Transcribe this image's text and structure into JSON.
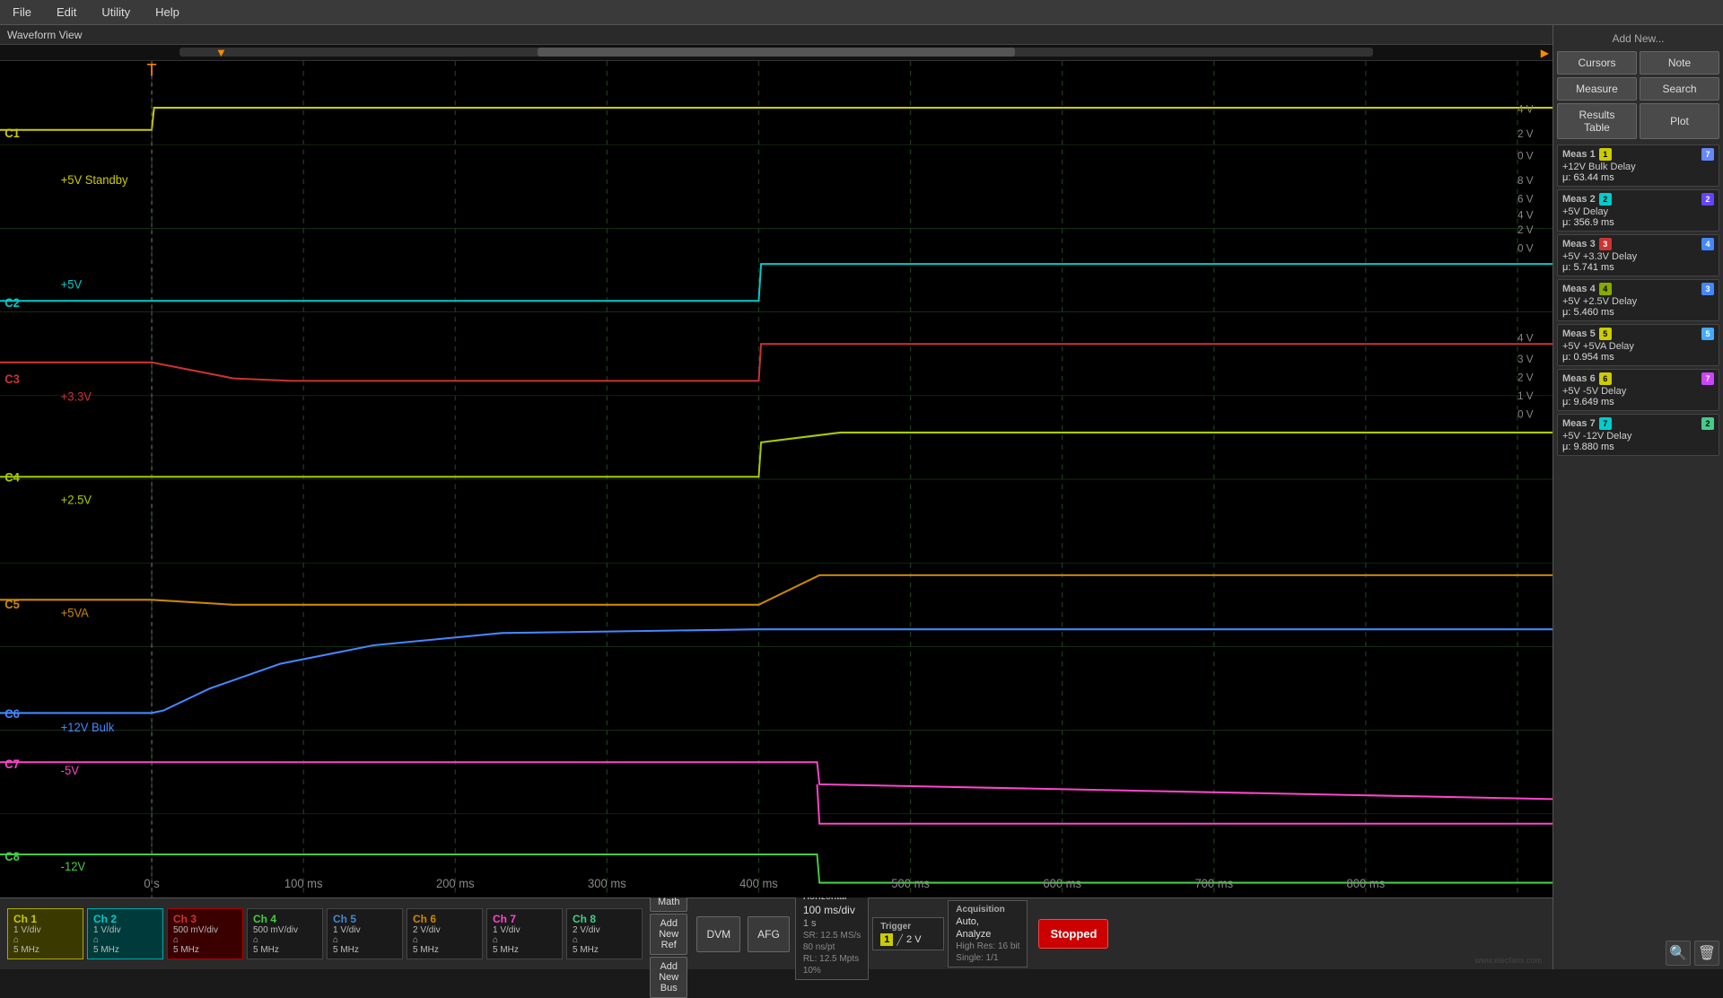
{
  "menubar": {
    "items": [
      "File",
      "Edit",
      "Utility",
      "Help"
    ]
  },
  "waveform": {
    "title": "Waveform View",
    "time_labels": [
      "0 s",
      "100 ms",
      "200 ms",
      "300 ms",
      "400 ms",
      "500 ms",
      "600 ms",
      "700 ms",
      "800 ms"
    ],
    "channels": [
      {
        "id": "C1",
        "name": "+5V Standby",
        "color": "#cccc00",
        "vdiv": "1 V/div",
        "bw": "",
        "y_pct": 12
      },
      {
        "id": "C2",
        "name": "+5V",
        "color": "#00cccc",
        "vdiv": "1 V/div",
        "bw": "",
        "y_pct": 24
      },
      {
        "id": "C3",
        "name": "+3.3V",
        "color": "#cc0000",
        "vdiv": "500 mV/div",
        "bw": "",
        "y_pct": 38
      },
      {
        "id": "C4",
        "name": "+2.5V",
        "color": "#aacc00",
        "vdiv": "500 mV/div",
        "bw": "",
        "y_pct": 50
      },
      {
        "id": "C5",
        "name": "+5VA",
        "color": "#cc8800",
        "vdiv": "1 V/div",
        "bw": "",
        "y_pct": 60
      },
      {
        "id": "C6",
        "name": "+12V Bulk",
        "color": "#4488ff",
        "vdiv": "2 V/div",
        "bw": "",
        "y_pct": 72
      },
      {
        "id": "C7",
        "name": "-5V",
        "color": "#ff44cc",
        "vdiv": "1 V/div",
        "bw": "",
        "y_pct": 78
      },
      {
        "id": "C8",
        "name": "-12V",
        "color": "#44cc44",
        "vdiv": "2 V/div",
        "bw": "",
        "y_pct": 88
      }
    ]
  },
  "right_panel": {
    "add_new_label": "Add New...",
    "buttons": {
      "cursors": "Cursors",
      "note": "Note",
      "measure": "Measure",
      "search": "Search",
      "results_table": "Results\nTable",
      "plot": "Plot"
    },
    "measurements": [
      {
        "id": "Meas 1",
        "badge_num": "1",
        "badge_color": "#cccc00",
        "ch_badge_color": "#6688ff",
        "ch_badge_text": "7",
        "title": "+12V Bulk Delay",
        "value": "μ: 63.44 ms"
      },
      {
        "id": "Meas 2",
        "badge_num": "2",
        "badge_color": "#00cccc",
        "ch_badge_color": "#6644ff",
        "ch_badge_text": "2",
        "title": "+5V Delay",
        "value": "μ: 356.9 ms"
      },
      {
        "id": "Meas 3",
        "badge_num": "3",
        "badge_color": "#cc0000",
        "ch_badge_color": "#4488ff",
        "ch_badge_text": "4",
        "title": "+5V +3.3V Delay",
        "value": "μ: 5.741 ms"
      },
      {
        "id": "Meas 4",
        "badge_num": "4",
        "badge_color": "#88aa00",
        "ch_badge_color": "#4488ff",
        "ch_badge_text": "3",
        "title": "+5V +2.5V Delay",
        "value": "μ: 5.460 ms"
      },
      {
        "id": "Meas 5",
        "badge_num": "5",
        "badge_color": "#cccc00",
        "ch_badge_color": "#44aaff",
        "ch_badge_text": "5",
        "title": "+5V +5VA Delay",
        "value": "μ: 0.954 ms"
      },
      {
        "id": "Meas 6",
        "badge_num": "6",
        "badge_color": "#cccc00",
        "ch_badge_color": "#cc44ff",
        "ch_badge_text": "7",
        "title": "+5V -5V Delay",
        "value": "μ: 9.649 ms"
      },
      {
        "id": "Meas 7",
        "badge_num": "7",
        "badge_color": "#00cccc",
        "ch_badge_color": "#44cc88",
        "ch_badge_text": "2",
        "title": "+5V -12V Delay",
        "value": "μ: 9.880 ms"
      }
    ]
  },
  "bottom_toolbar": {
    "channels": [
      {
        "id": "Ch 1",
        "vdiv": "1 V/div",
        "bw": "⌂",
        "freq": "5 MHz",
        "class": "active-ch1",
        "color": "#cccc00"
      },
      {
        "id": "Ch 2",
        "vdiv": "1 V/div",
        "bw": "⌂",
        "freq": "5 MHz",
        "class": "active-ch2",
        "color": "#00cccc"
      },
      {
        "id": "Ch 3",
        "vdiv": "500 mV/div",
        "bw": "⌂",
        "freq": "5 MHz",
        "class": "active-ch3",
        "color": "#cc3333"
      },
      {
        "id": "Ch 4",
        "vdiv": "500 mV/div",
        "bw": "⌂",
        "freq": "5 MHz",
        "class": "active-ch4",
        "color": "#44cc44"
      },
      {
        "id": "Ch 5",
        "vdiv": "1 V/div",
        "bw": "⌂",
        "freq": "5 MHz",
        "class": "active-ch5",
        "color": "#4466cc"
      },
      {
        "id": "Ch 6",
        "vdiv": "2 V/div",
        "bw": "⌂",
        "freq": "5 MHz",
        "class": "active-ch6",
        "color": "#cc8800"
      },
      {
        "id": "Ch 7",
        "vdiv": "1 V/div",
        "bw": "⌂",
        "freq": "5 MHz",
        "class": "active-ch7",
        "color": "#cc44cc"
      },
      {
        "id": "Ch 8",
        "vdiv": "2 V/div",
        "bw": "⌂",
        "freq": "5 MHz",
        "class": "active-ch8",
        "color": "#44cc88"
      }
    ],
    "add_buttons": [
      "Add\nNew\nMath",
      "Add\nNew\nRef",
      "Add\nNew\nBus"
    ],
    "dvm_label": "DVM",
    "afg_label": "AFG",
    "horizontal": {
      "title": "Horizontal",
      "timebase": "100 ms/div",
      "delay": "1 s",
      "sr": "SR: 12.5 MS/s",
      "pts": "80 ns/pt",
      "rl": "RL: 12.5 Mpts",
      "trig": "10%"
    },
    "trigger": {
      "title": "Trigger",
      "ch": "1",
      "level": "2 V"
    },
    "acquisition": {
      "title": "Acquisition",
      "mode": "Auto,",
      "mode2": "Analyze",
      "res": "High Res: 16 bit",
      "single": "Single: 1/1"
    },
    "stopped": "Stopped"
  }
}
